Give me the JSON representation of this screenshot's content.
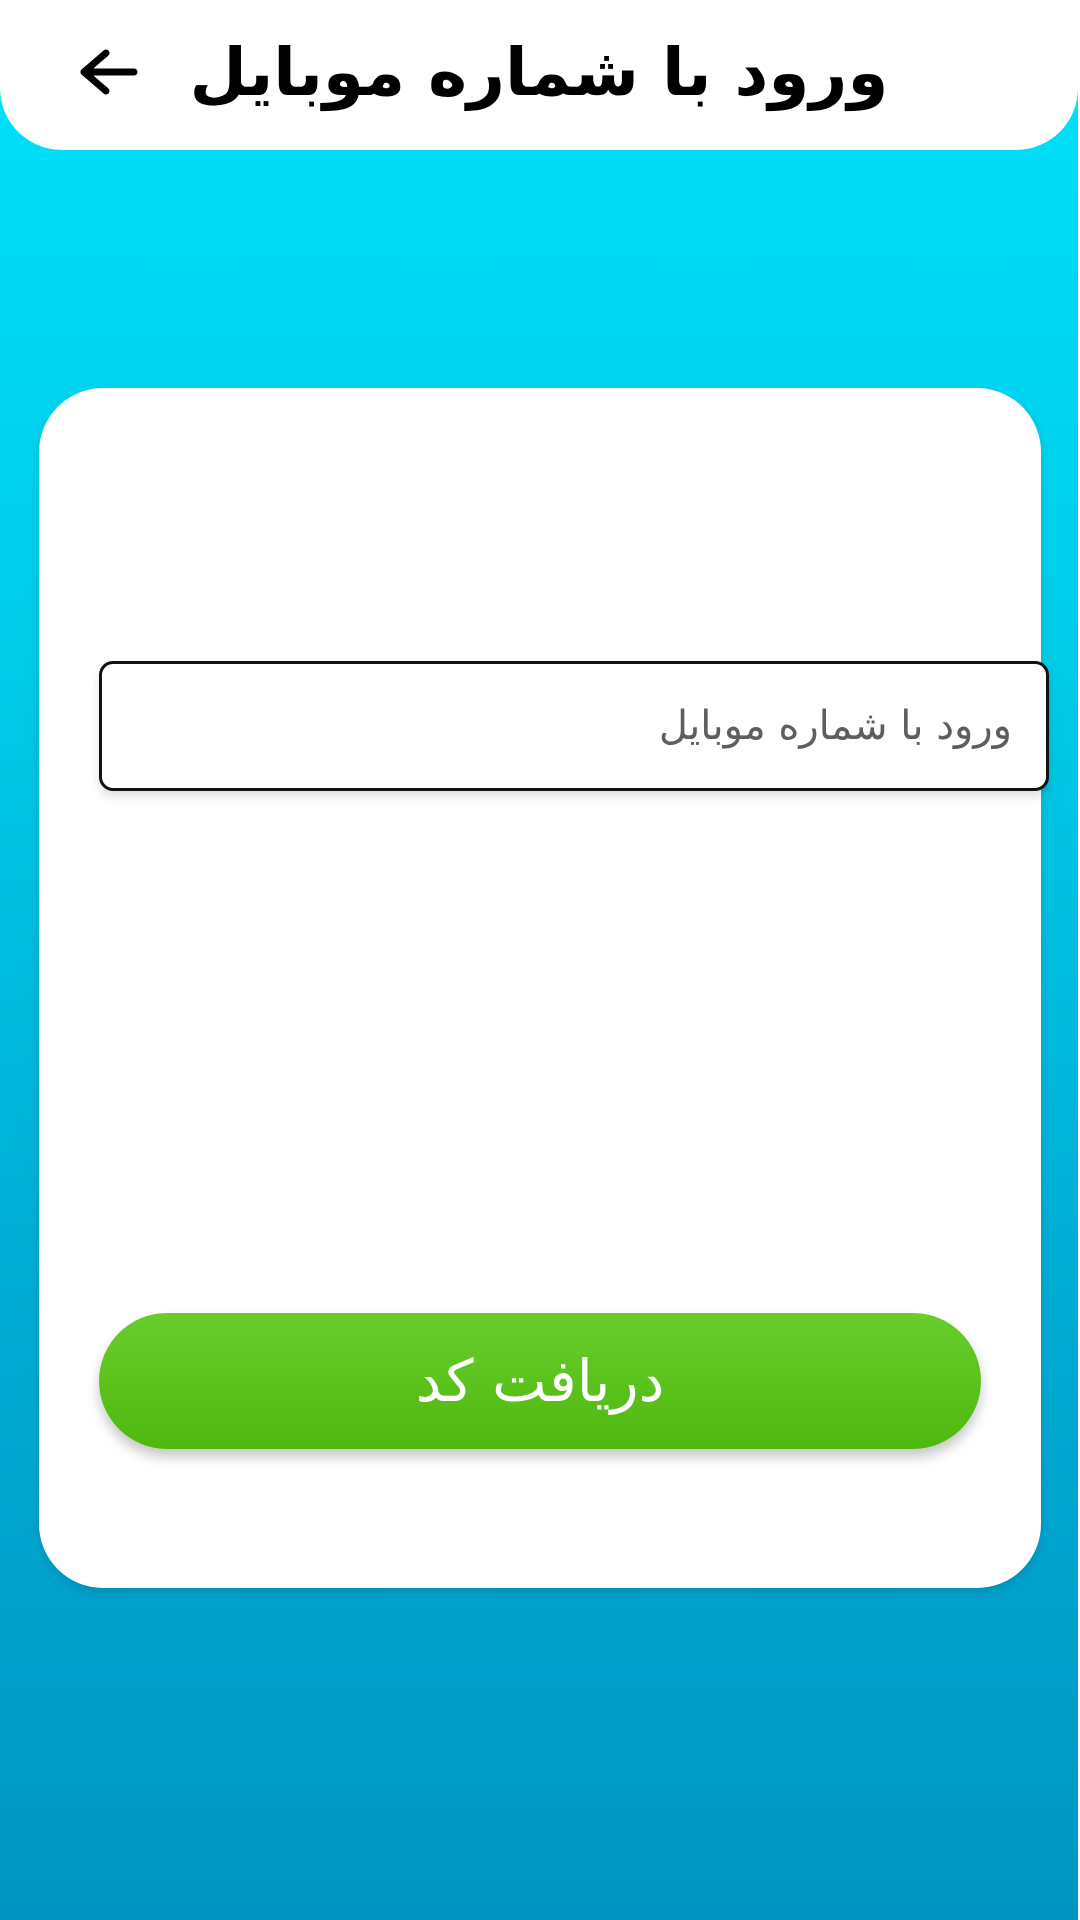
{
  "app_bar": {
    "title": "ورود با شماره موبایل",
    "back_icon": "arrow-left-icon"
  },
  "login_form": {
    "phone_input": {
      "value": "",
      "placeholder": "ورود با شماره موبایل"
    },
    "submit_label": "دریافت کد"
  },
  "colors": {
    "background_top": "#00e2fb",
    "background_bottom": "#0095c3",
    "button_green": "#5cc41e",
    "surface": "#ffffff"
  }
}
